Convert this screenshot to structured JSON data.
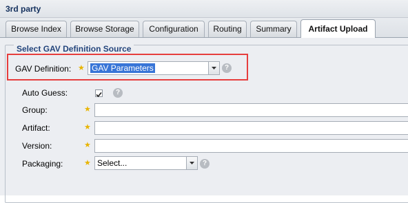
{
  "panel": {
    "title": "3rd party"
  },
  "tabs": [
    {
      "label": "Browse Index"
    },
    {
      "label": "Browse Storage"
    },
    {
      "label": "Configuration"
    },
    {
      "label": "Routing"
    },
    {
      "label": "Summary"
    },
    {
      "label": "Artifact Upload",
      "active": true
    }
  ],
  "form": {
    "legend": "Select GAV Definition Source",
    "gav_definition": {
      "label": "GAV Definition:",
      "value": "GAV Parameters"
    },
    "auto_guess": {
      "label": "Auto Guess:",
      "checked": true
    },
    "group": {
      "label": "Group:",
      "value": ""
    },
    "artifact": {
      "label": "Artifact:",
      "value": ""
    },
    "version": {
      "label": "Version:",
      "value": ""
    },
    "packaging": {
      "label": "Packaging:",
      "value": "Select..."
    }
  },
  "colors": {
    "highlight": "#e63d3d",
    "required_star": "#e8b400",
    "legend_text": "#24457c",
    "selection": "#3875d7"
  },
  "icons": [
    "help-icon",
    "star-icon",
    "dropdown-arrow-icon",
    "checkmark-icon"
  ]
}
